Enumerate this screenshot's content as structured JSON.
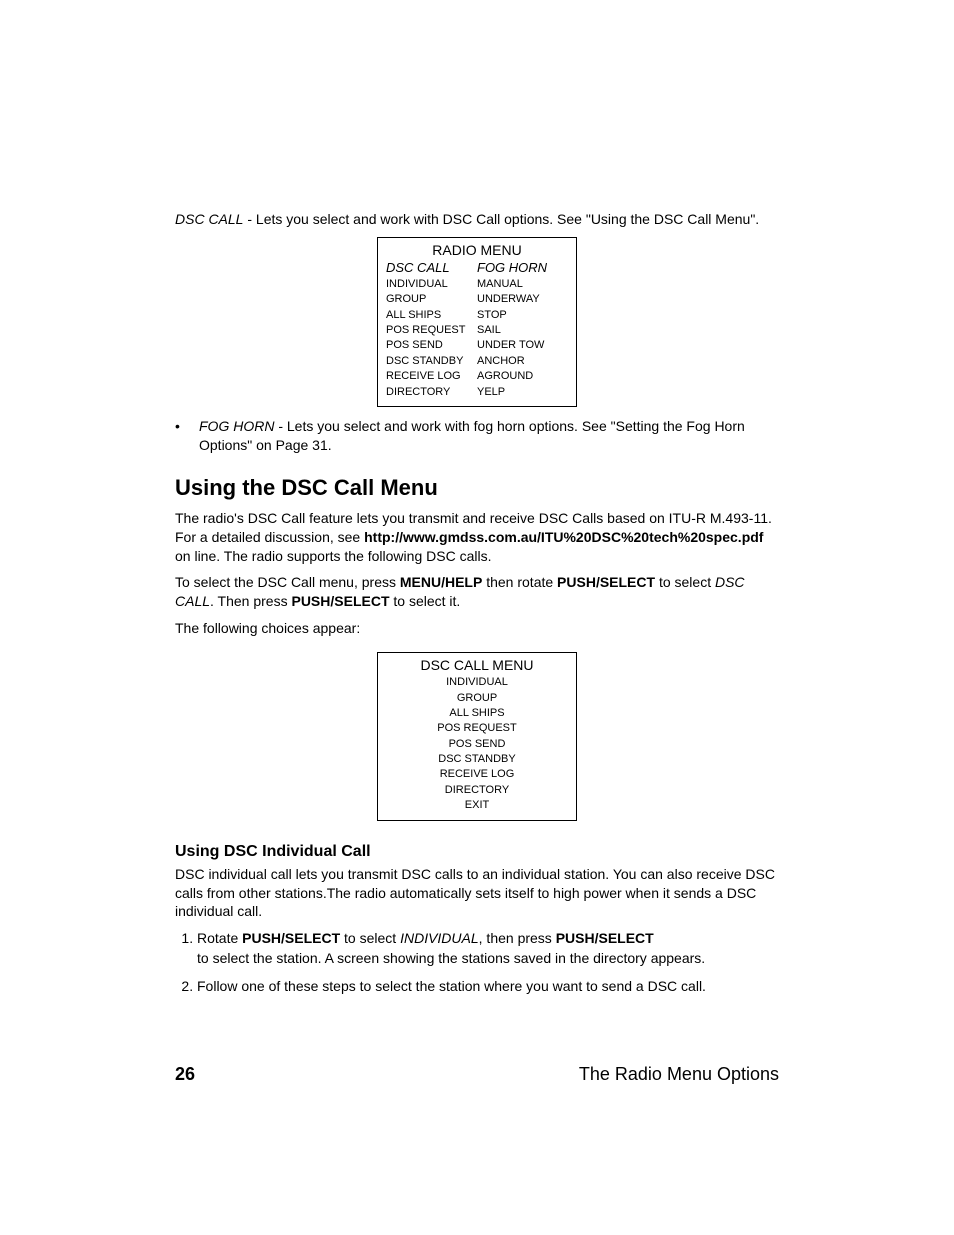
{
  "intro": {
    "dsc_call_label": "DSC CALL",
    "dsc_call_text": " - Lets you select and work with DSC Call options. See \"Using the DSC Call Menu\"."
  },
  "radio_menu": {
    "title": "RADIO MENU",
    "col1_head": "DSC CALL",
    "col1": [
      "INDIVIDUAL",
      "GROUP",
      "ALL SHIPS",
      "POS REQUEST",
      "POS SEND",
      "DSC STANDBY",
      "RECEIVE LOG",
      "DIRECTORY"
    ],
    "col2_head": "FOG HORN",
    "col2": [
      "MANUAL",
      "UNDERWAY",
      "STOP",
      "SAIL",
      "UNDER TOW",
      "ANCHOR",
      "AGROUND",
      "YELP"
    ]
  },
  "foghorn_bullet": {
    "label": "FOG HORN",
    "text": " - Lets you select and work with fog horn options. See \"Setting the Fog Horn Options\" on Page 31."
  },
  "section_heading": "Using the DSC Call Menu",
  "section_para1_a": "The radio's DSC Call feature lets you transmit and receive DSC Calls based on ITU-R M.493-11. For a detailed discussion, see ",
  "section_para1_bold": "http://www.gmdss.com.au/ITU%20DSC%20tech%20spec.pdf",
  "section_para1_b": " on line. The radio supports the following DSC calls.",
  "section_para2_a": "To select the DSC Call menu, press ",
  "section_para2_b1": "MENU/HELP",
  "section_para2_c": " then rotate ",
  "section_para2_b2": "PUSH/SELECT",
  "section_para2_d": " to select ",
  "section_para2_ital": "DSC CALL",
  "section_para2_e": ". Then press ",
  "section_para2_b3": "PUSH/SELECT",
  "section_para2_f": " to select it.",
  "section_para3": "The following choices appear:",
  "dsc_menu": {
    "title": "DSC CALL MENU",
    "items": [
      "INDIVIDUAL",
      "GROUP",
      "ALL SHIPS",
      "POS REQUEST",
      "POS SEND",
      "DSC STANDBY",
      "RECEIVE LOG",
      "DIRECTORY",
      "EXIT"
    ]
  },
  "subsection_heading": "Using DSC Individual Call",
  "sub_para": "DSC individual call lets you transmit DSC calls to an individual station. You can also receive DSC calls from other stations.The radio automatically sets itself to high power when it sends a DSC individual call.",
  "steps": {
    "s1_a": "Rotate ",
    "s1_b1": "PUSH/SELECT",
    "s1_b": " to select ",
    "s1_ital": "INDIVIDUAL",
    "s1_c": ", then press ",
    "s1_b2": "PUSH/SELECT",
    "s1_d": " to select the station. A screen showing the stations saved in the directory appears.",
    "s2": "Follow one of these steps to select the station where you want to send a DSC call."
  },
  "footer": {
    "page": "26",
    "chapter": "The Radio Menu Options"
  }
}
